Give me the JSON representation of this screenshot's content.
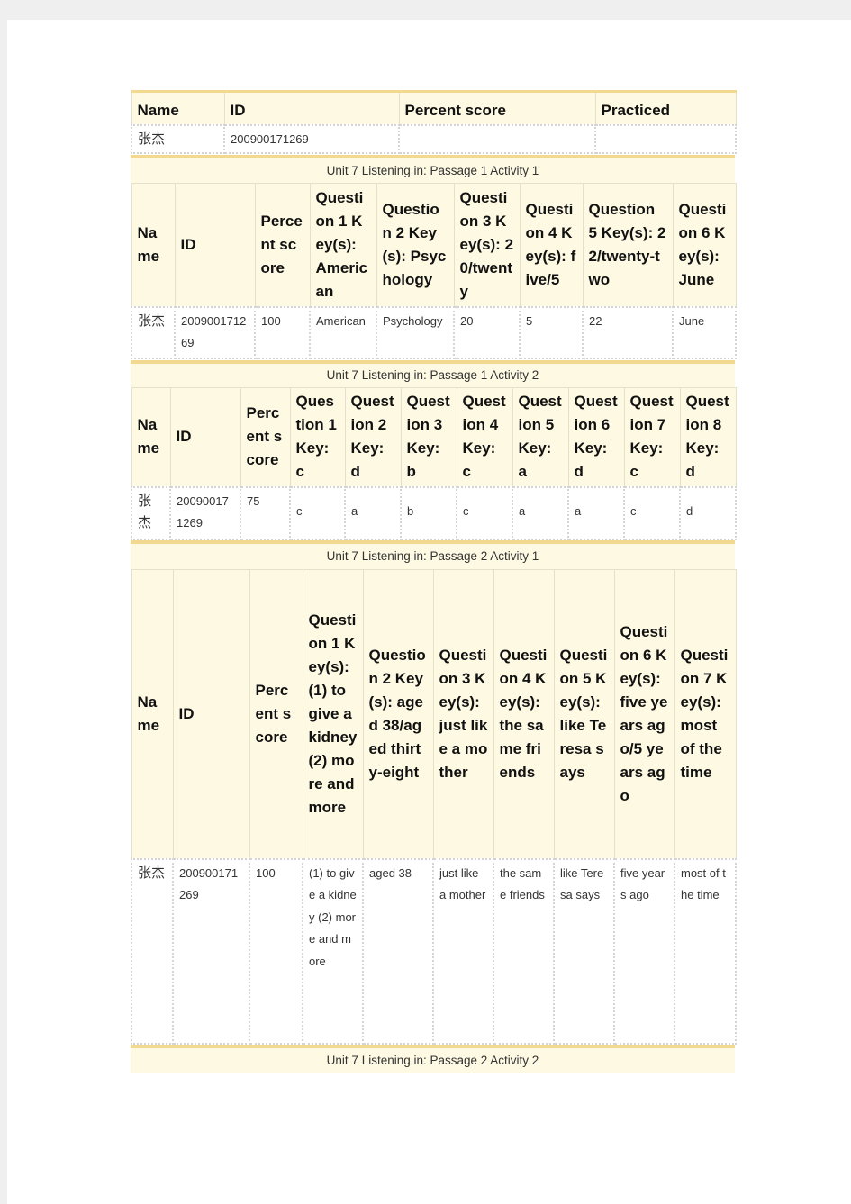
{
  "summary": {
    "headers": [
      "Name",
      "ID",
      "Percent score",
      "Practiced"
    ],
    "row": [
      "张杰",
      "200900171269",
      "",
      ""
    ]
  },
  "activities": [
    {
      "caption": "Unit 7 Listening in: Passage 1 Activity 1",
      "headers": [
        "Name",
        "ID",
        "Percent score",
        "Question 1 Key(s): American",
        "Question 2 Key(s): Psychology",
        "Question 3 Key(s): 20/twenty",
        "Question 4 Key(s): five/5",
        "Question 5 Key(s): 22/twenty-two",
        "Question 6 Key(s): June"
      ],
      "row": [
        "张杰",
        "200900171269",
        "100",
        "American",
        "Psychology",
        "20",
        "5",
        "22",
        "June"
      ]
    },
    {
      "caption": "Unit 7 Listening in: Passage 1 Activity 2",
      "headers": [
        "Name",
        "ID",
        "Percent score",
        "Question 1 Key: c",
        "Question 2 Key: d",
        "Question 3 Key: b",
        "Question 4 Key: c",
        "Question 5 Key: a",
        "Question 6 Key: d",
        "Question 7 Key: c",
        "Question 8 Key: d"
      ],
      "row": [
        "张杰",
        "200900171269",
        "75",
        "c",
        "a",
        "b",
        "c",
        "a",
        "a",
        "c",
        "d"
      ]
    },
    {
      "caption": "Unit 7 Listening in: Passage 2 Activity 1",
      "headers": [
        "Name",
        "ID",
        "Percent score",
        "Question 1 Key(s): (1) to give a kidney (2) more and more",
        "Question 2 Key(s): aged 38/aged thirty-eight",
        "Question 3 Key(s): just like a mother",
        "Question 4 Key(s): the same friends",
        "Question 5 Key(s): like Teresa says",
        "Question 6 Key(s): five years ago/5 years ago",
        "Question 7 Key(s): most of the time"
      ],
      "row": [
        "张杰",
        "200900171269",
        "100",
        "(1) to give a kidney (2) more and more",
        "aged 38",
        "just like a mother",
        "the same friends",
        "like Teresa says",
        "five years ago",
        "most of the time"
      ]
    },
    {
      "caption": "Unit 7 Listening in: Passage 2 Activity 2"
    }
  ]
}
